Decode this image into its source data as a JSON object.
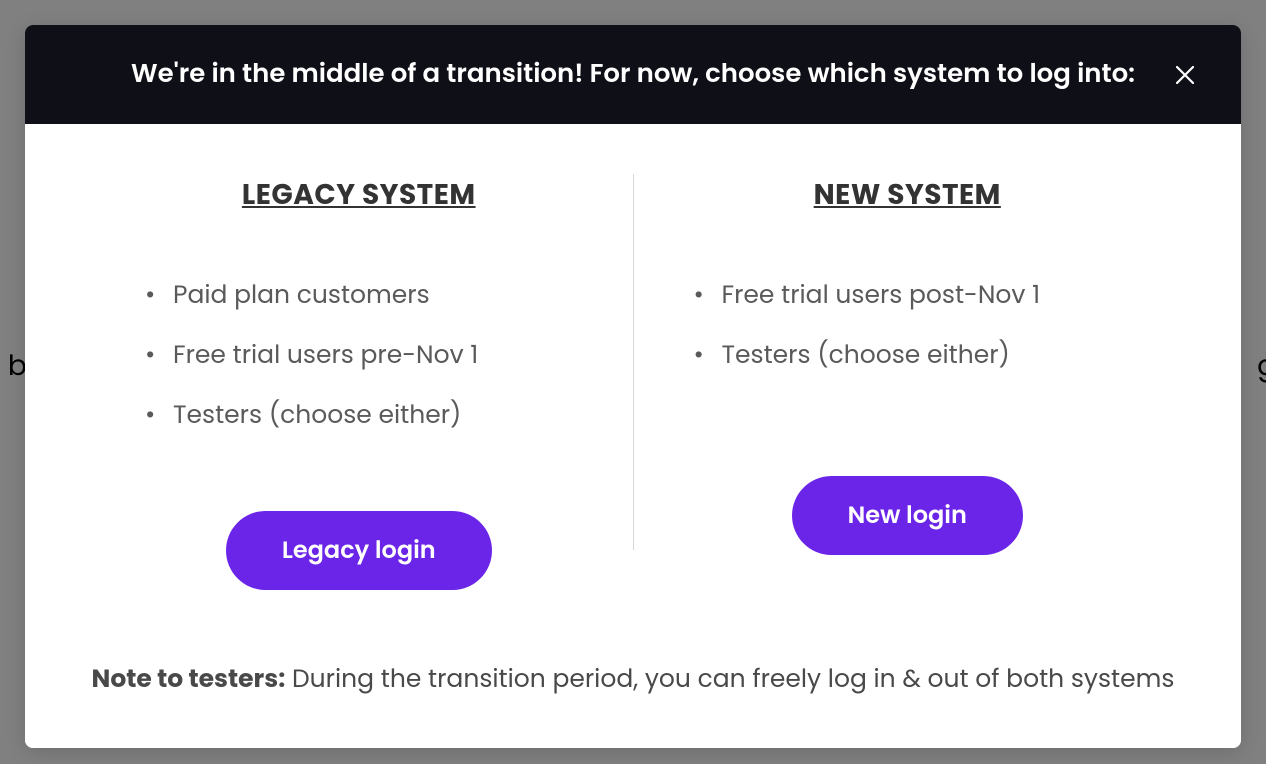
{
  "background": {
    "left_fragment": "r b",
    "right_fragment": "g"
  },
  "modal": {
    "header_text": "We're in the middle of a transition! For now, choose which system to log into:",
    "legacy": {
      "title": "LEGACY SYSTEM",
      "bullets": [
        "Paid plan customers",
        "Free trial users pre-Nov 1",
        "Testers (choose either)"
      ],
      "button_label": "Legacy login"
    },
    "new": {
      "title": "NEW SYSTEM",
      "bullets": [
        "Free trial users post-Nov 1",
        "Testers (choose either)"
      ],
      "button_label": "New login"
    },
    "note": {
      "label": "Note to testers:",
      "text": "During the transition period, you can freely log in & out of both systems"
    }
  },
  "colors": {
    "accent": "#6a25e8",
    "header_bg": "#0f0f17"
  }
}
